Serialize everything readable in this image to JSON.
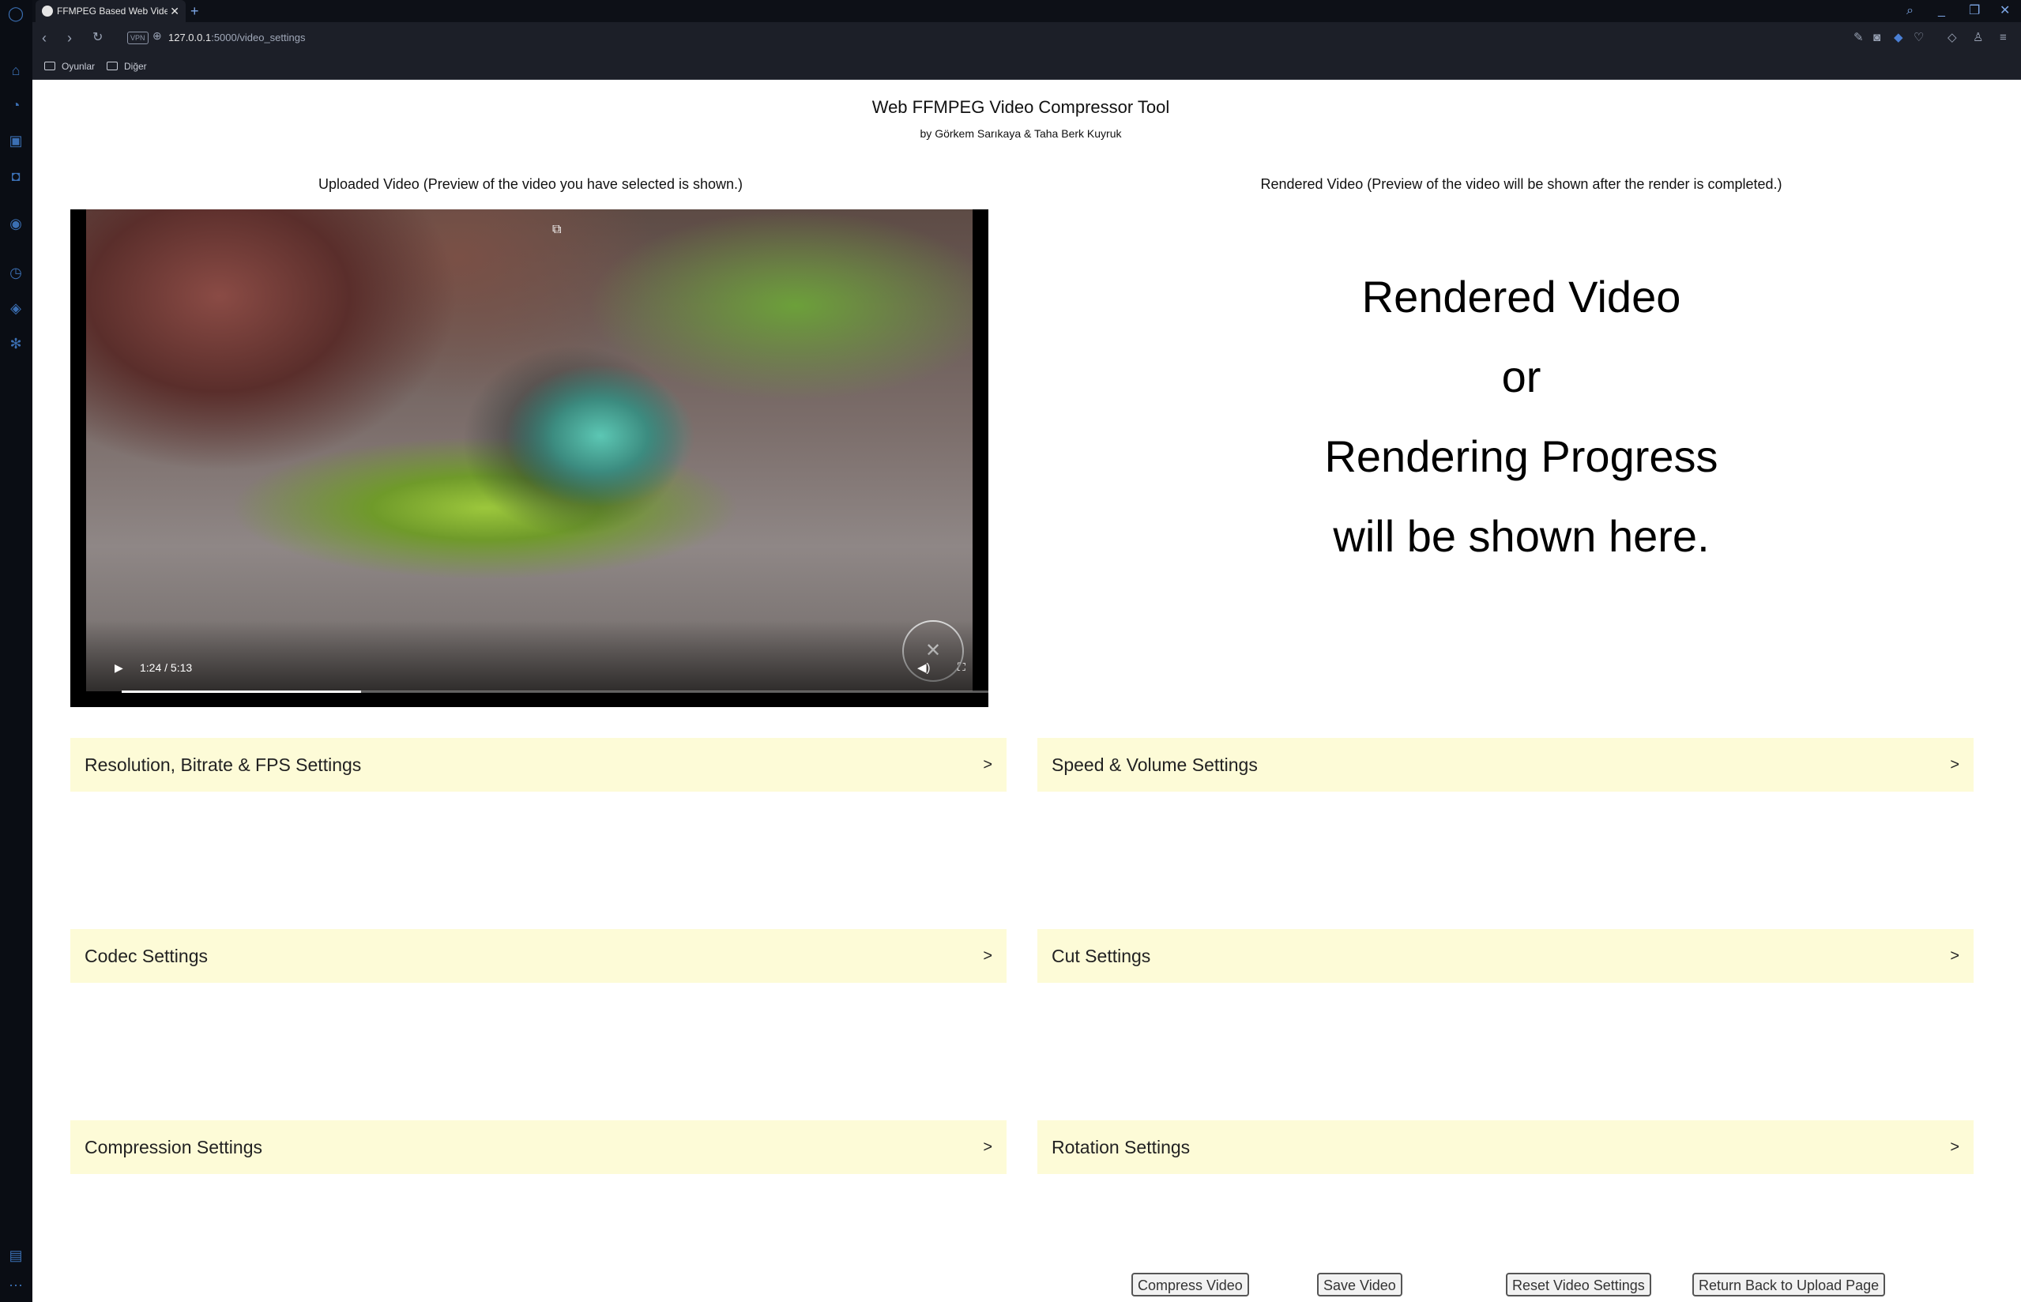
{
  "browser": {
    "tab_title": "FFMPEG Based Web Video",
    "url_host": "127.0.0.1",
    "url_path": ":5000/video_settings",
    "vpn_badge": "VPN",
    "bookmarks": [
      "Oyunlar",
      "Diğer"
    ]
  },
  "header": {
    "title": "Web FFMPEG Video Compressor Tool",
    "subtitle": "by Görkem Sarıkaya & Taha Berk Kuyruk"
  },
  "uploaded": {
    "heading": "Uploaded Video (Preview of the video you have selected is shown.)",
    "player": {
      "time": "1:24 / 5:13",
      "progress": 0.268
    }
  },
  "rendered": {
    "heading": "Rendered Video (Preview of the video will be shown after the render is completed.)",
    "placeholder_lines": [
      "Rendered Video",
      "or",
      "Rendering Progress",
      "will be shown here."
    ]
  },
  "settings": {
    "resolution": "Resolution, Bitrate & FPS Settings",
    "speed": "Speed & Volume Settings",
    "codec": "Codec Settings",
    "cut": "Cut Settings",
    "compression": "Compression Settings",
    "rotation": "Rotation Settings",
    "chevron": ">"
  },
  "actions": {
    "compress": "Compress Video",
    "save": "Save Video",
    "reset": "Reset Video Settings",
    "return": "Return Back to Upload Page"
  },
  "colors": {
    "accordion_bg": "#fdfbd7",
    "chrome_bg": "#1c1f28",
    "sidebar_bg": "#0a0d14"
  }
}
